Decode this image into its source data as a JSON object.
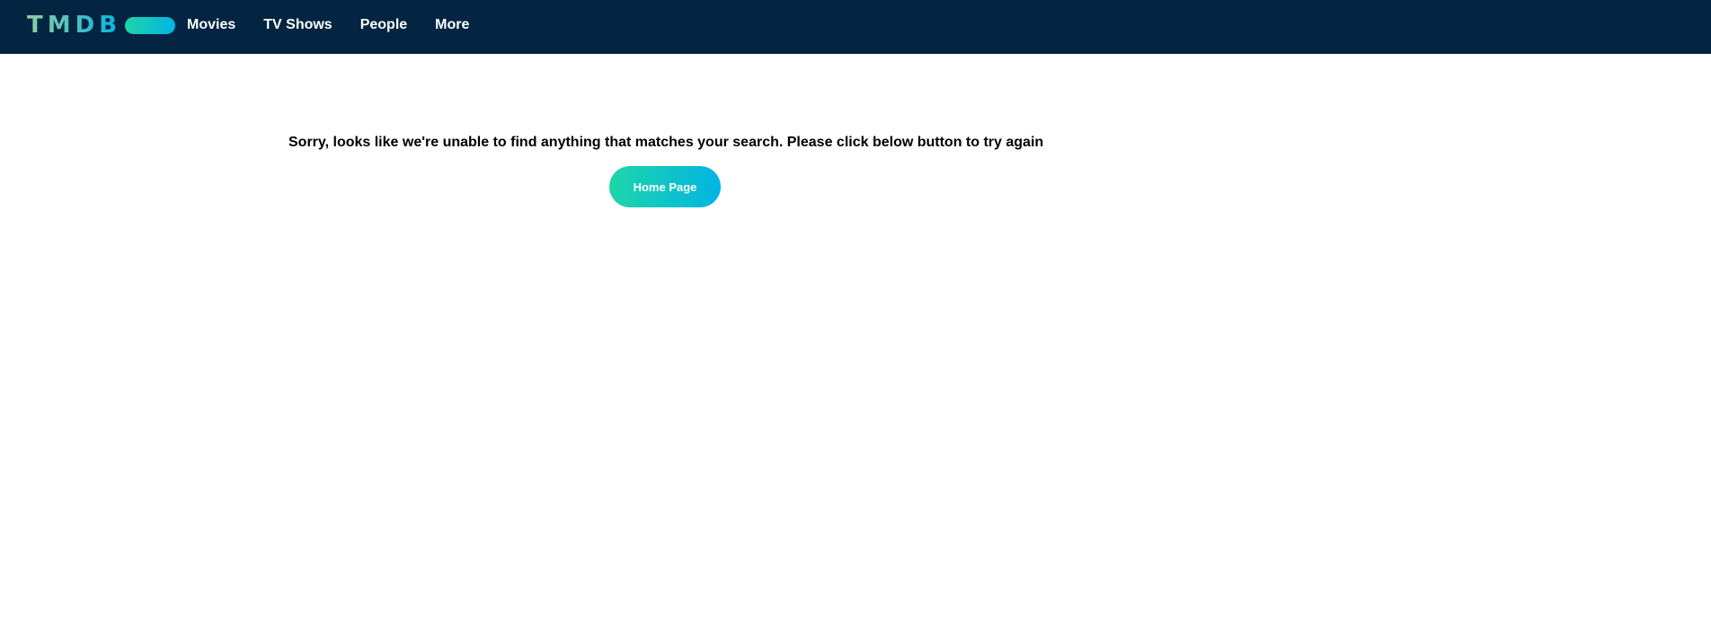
{
  "header": {
    "logo_text": "TMDB",
    "nav": [
      {
        "label": "Movies"
      },
      {
        "label": "TV Shows"
      },
      {
        "label": "People"
      },
      {
        "label": "More"
      }
    ]
  },
  "main": {
    "message": "Sorry, looks like we're unable to find anything that matches your search. Please click below button to try again",
    "home_button_label": "Home Page"
  },
  "colors": {
    "header_bg": "#032541",
    "accent_start": "#1ed5a9",
    "accent_end": "#01b4e4",
    "logo_green": "#90cea1"
  }
}
